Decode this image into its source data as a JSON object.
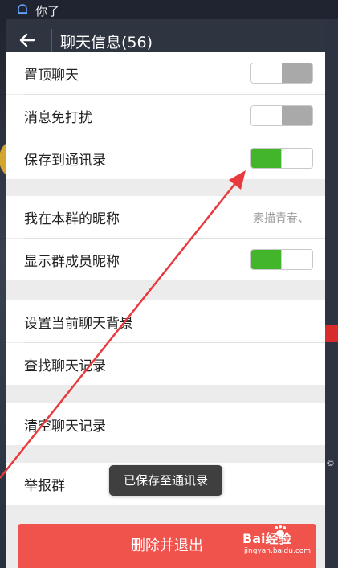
{
  "status_bar": {
    "text": "你了"
  },
  "header": {
    "title": "聊天信息(56)"
  },
  "settings": {
    "pin_chat": "置顶聊天",
    "mute": "消息免打扰",
    "save_contacts": "保存到通讯录",
    "nickname_label": "我在本群的昵称",
    "nickname_value": "素描青春、",
    "show_member_names": "显示群成员昵称",
    "set_background": "设置当前聊天背景",
    "search_history": "查找聊天记录",
    "clear_history": "清空聊天记录",
    "report_group": "举报群"
  },
  "toggles": {
    "pin_chat": false,
    "mute": false,
    "save_contacts": true,
    "show_member_names": true
  },
  "toast": {
    "text": "已保存至通讯录"
  },
  "exit_button": {
    "label": "删除并退出"
  },
  "watermark": {
    "brand": "Bai经验",
    "url": "jingyan.baidu.com"
  },
  "colors": {
    "toggle_on": "#43b52b",
    "exit_button": "#f0524c",
    "annotation_arrow": "#e8393d"
  }
}
